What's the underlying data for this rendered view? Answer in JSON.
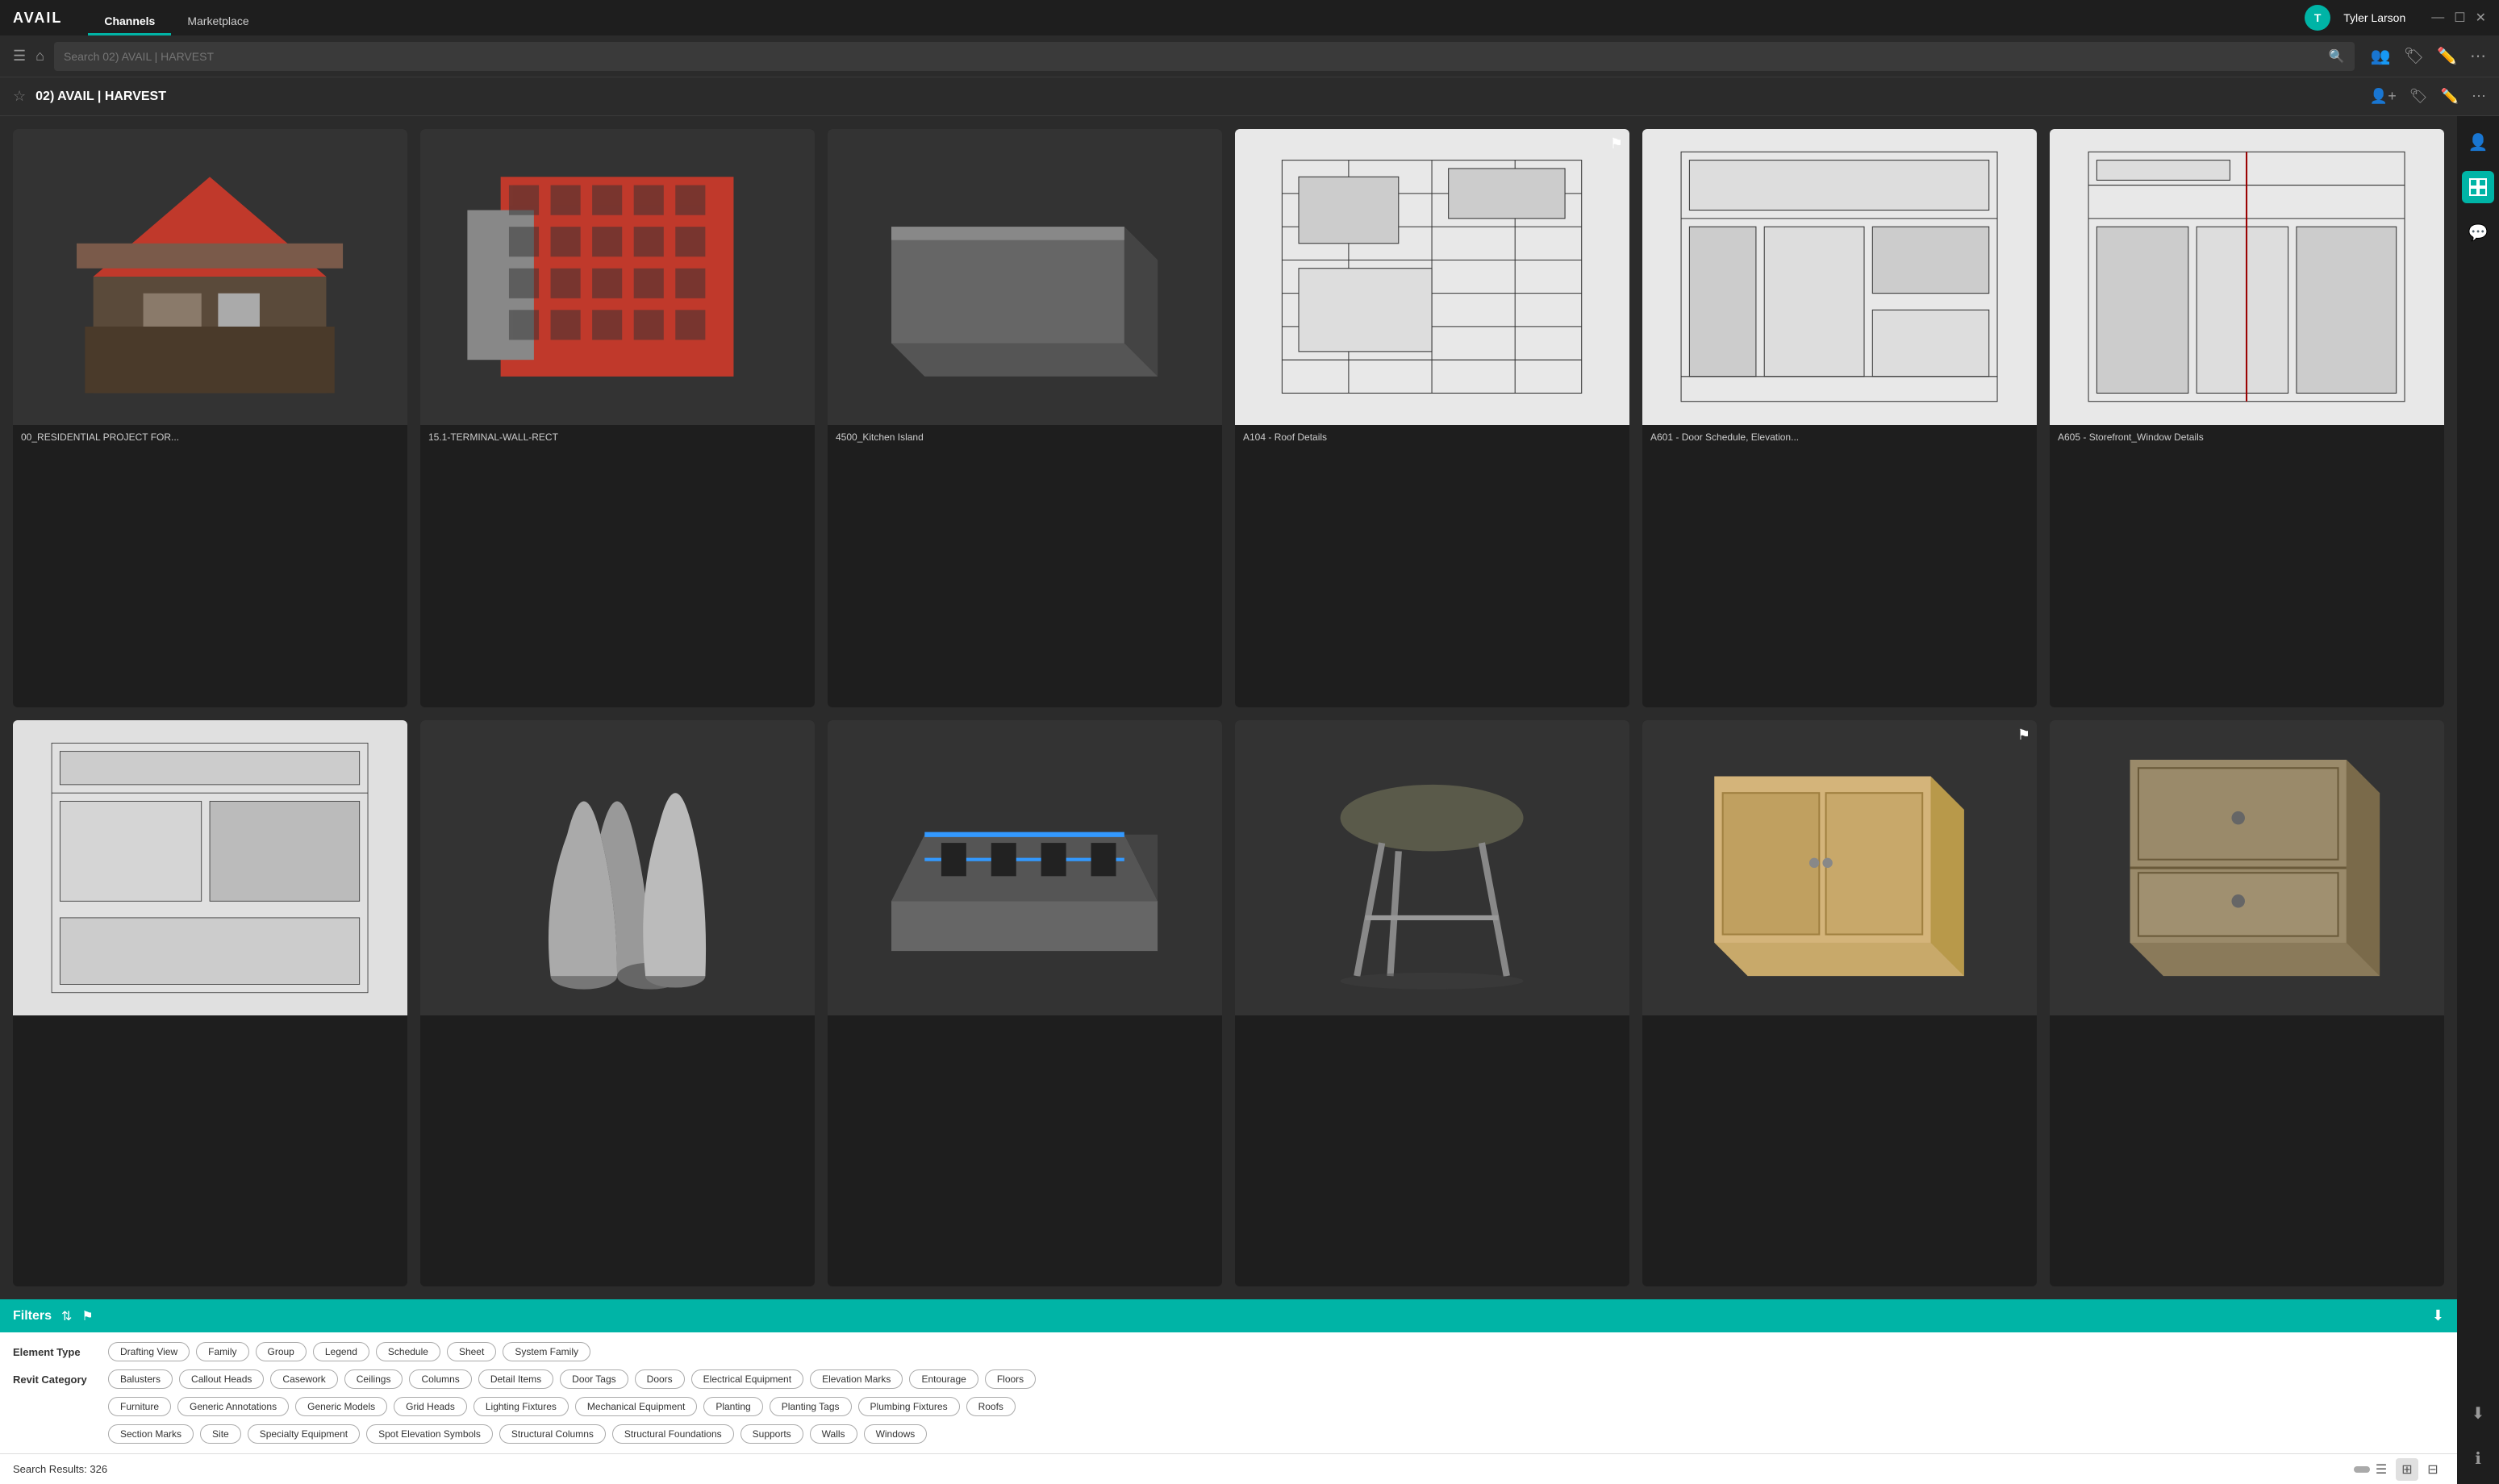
{
  "app": {
    "logo": "AVAIL",
    "nav": [
      {
        "id": "channels",
        "label": "Channels",
        "active": true
      },
      {
        "id": "marketplace",
        "label": "Marketplace",
        "active": false
      }
    ],
    "window_controls": [
      "—",
      "☐",
      "✕"
    ]
  },
  "user": {
    "initial": "T",
    "name": "Tyler Larson"
  },
  "toolbar": {
    "search_placeholder": "Search 02) AVAIL | HARVEST",
    "search_value": ""
  },
  "channel": {
    "name": "02) AVAIL | HARVEST",
    "starred": false
  },
  "grid": {
    "items": [
      {
        "id": 1,
        "label": "00_RESIDENTIAL PROJECT FOR...",
        "flagged": false,
        "type": "3d-house"
      },
      {
        "id": 2,
        "label": "15.1-TERMINAL-WALL-RECT",
        "flagged": false,
        "type": "3d-wall"
      },
      {
        "id": 3,
        "label": "4500_Kitchen Island",
        "flagged": false,
        "type": "3d-box-dark"
      },
      {
        "id": 4,
        "label": "A104 - Roof Details",
        "flagged": true,
        "type": "blueprint"
      },
      {
        "id": 5,
        "label": "A601 - Door Schedule, Elevation...",
        "flagged": false,
        "type": "blueprint"
      },
      {
        "id": 6,
        "label": "A605 - Storefront_Window Details",
        "flagged": false,
        "type": "blueprint"
      },
      {
        "id": 7,
        "label": "",
        "flagged": false,
        "type": "blueprint-small"
      },
      {
        "id": 8,
        "label": "",
        "flagged": false,
        "type": "3d-columns"
      },
      {
        "id": 9,
        "label": "",
        "flagged": false,
        "type": "3d-train"
      },
      {
        "id": 10,
        "label": "",
        "flagged": false,
        "type": "3d-stool"
      },
      {
        "id": 11,
        "label": "",
        "flagged": true,
        "type": "3d-cabinet"
      },
      {
        "id": 12,
        "label": "",
        "flagged": false,
        "type": "3d-cabinet2"
      }
    ]
  },
  "filters": {
    "title": "Filters",
    "element_type_label": "Element Type",
    "element_types": [
      "Drafting View",
      "Family",
      "Group",
      "Legend",
      "Schedule",
      "Sheet",
      "System Family"
    ],
    "revit_category_label": "Revit Category",
    "revit_categories_row1": [
      "Balusters",
      "Callout Heads",
      "Casework",
      "Ceilings",
      "Columns",
      "Detail Items",
      "Door Tags",
      "Doors",
      "Electrical Equipment",
      "Elevation Marks",
      "Entourage",
      "Floors"
    ],
    "revit_categories_row2": [
      "Furniture",
      "Generic Annotations",
      "Generic Models",
      "Grid Heads",
      "Lighting Fixtures",
      "Mechanical Equipment",
      "Planting",
      "Planting Tags",
      "Plumbing Fixtures",
      "Roofs"
    ],
    "revit_categories_row3": [
      "Section Marks",
      "Site",
      "Specialty Equipment",
      "Spot Elevation Symbols",
      "Structural Columns",
      "Structural Foundations",
      "Supports",
      "Walls",
      "Windows"
    ]
  },
  "status": {
    "search_results_label": "Search Results:",
    "search_results_count": "326"
  },
  "right_sidebar": {
    "icons": [
      {
        "id": "grid-icon",
        "active": true
      },
      {
        "id": "chat-icon",
        "active": false
      },
      {
        "id": "info-icon",
        "active": false
      },
      {
        "id": "download-icon",
        "active": false
      }
    ]
  }
}
